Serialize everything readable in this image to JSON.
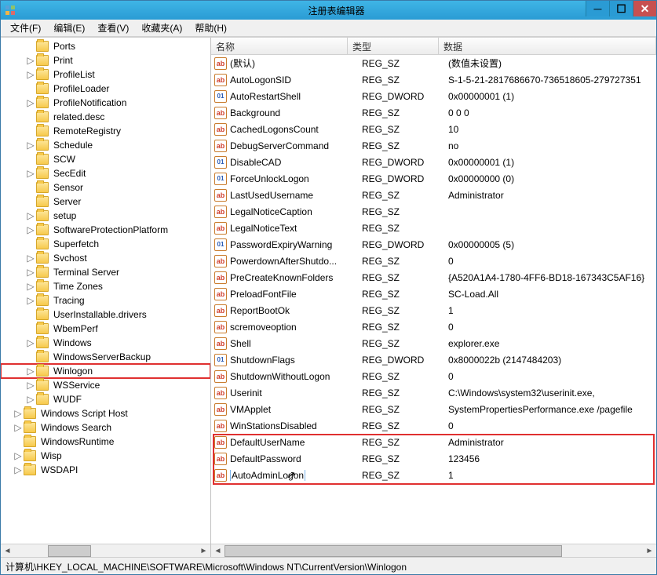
{
  "window": {
    "title": "注册表编辑器"
  },
  "menus": [
    {
      "label": "文件(F)"
    },
    {
      "label": "编辑(E)"
    },
    {
      "label": "查看(V)"
    },
    {
      "label": "收藏夹(A)"
    },
    {
      "label": "帮助(H)"
    }
  ],
  "tree": [
    {
      "indent": 7,
      "exp": "",
      "label": "Ports"
    },
    {
      "indent": 7,
      "exp": "▷",
      "label": "Print"
    },
    {
      "indent": 7,
      "exp": "▷",
      "label": "ProfileList"
    },
    {
      "indent": 7,
      "exp": "",
      "label": "ProfileLoader"
    },
    {
      "indent": 7,
      "exp": "▷",
      "label": "ProfileNotification"
    },
    {
      "indent": 7,
      "exp": "",
      "label": "related.desc"
    },
    {
      "indent": 7,
      "exp": "",
      "label": "RemoteRegistry"
    },
    {
      "indent": 7,
      "exp": "▷",
      "label": "Schedule"
    },
    {
      "indent": 7,
      "exp": "",
      "label": "SCW"
    },
    {
      "indent": 7,
      "exp": "▷",
      "label": "SecEdit"
    },
    {
      "indent": 7,
      "exp": "",
      "label": "Sensor"
    },
    {
      "indent": 7,
      "exp": "",
      "label": "Server"
    },
    {
      "indent": 7,
      "exp": "▷",
      "label": "setup"
    },
    {
      "indent": 7,
      "exp": "▷",
      "label": "SoftwareProtectionPlatform"
    },
    {
      "indent": 7,
      "exp": "",
      "label": "Superfetch"
    },
    {
      "indent": 7,
      "exp": "▷",
      "label": "Svchost"
    },
    {
      "indent": 7,
      "exp": "▷",
      "label": "Terminal Server"
    },
    {
      "indent": 7,
      "exp": "▷",
      "label": "Time Zones"
    },
    {
      "indent": 7,
      "exp": "▷",
      "label": "Tracing"
    },
    {
      "indent": 7,
      "exp": "",
      "label": "UserInstallable.drivers"
    },
    {
      "indent": 7,
      "exp": "",
      "label": "WbemPerf"
    },
    {
      "indent": 7,
      "exp": "▷",
      "label": "Windows"
    },
    {
      "indent": 7,
      "exp": "",
      "label": "WindowsServerBackup"
    },
    {
      "indent": 7,
      "exp": "▷",
      "label": "Winlogon",
      "highlight": true
    },
    {
      "indent": 7,
      "exp": "▷",
      "label": "WSService"
    },
    {
      "indent": 7,
      "exp": "▷",
      "label": "WUDF"
    },
    {
      "indent": 6,
      "exp": "▷",
      "label": "Windows Script Host"
    },
    {
      "indent": 6,
      "exp": "▷",
      "label": "Windows Search"
    },
    {
      "indent": 6,
      "exp": "",
      "label": "WindowsRuntime"
    },
    {
      "indent": 6,
      "exp": "▷",
      "label": "Wisp"
    },
    {
      "indent": 6,
      "exp": "▷",
      "label": "WSDAPI"
    }
  ],
  "list": {
    "columns": {
      "name": "名称",
      "type": "类型",
      "data": "数据"
    },
    "rows": [
      {
        "icon": "sz",
        "name": "(默认)",
        "type": "REG_SZ",
        "data": "(数值未设置)"
      },
      {
        "icon": "sz",
        "name": "AutoLogonSID",
        "type": "REG_SZ",
        "data": "S-1-5-21-2817686670-736518605-279727351"
      },
      {
        "icon": "dw",
        "name": "AutoRestartShell",
        "type": "REG_DWORD",
        "data": "0x00000001 (1)"
      },
      {
        "icon": "sz",
        "name": "Background",
        "type": "REG_SZ",
        "data": "0 0 0"
      },
      {
        "icon": "sz",
        "name": "CachedLogonsCount",
        "type": "REG_SZ",
        "data": "10"
      },
      {
        "icon": "sz",
        "name": "DebugServerCommand",
        "type": "REG_SZ",
        "data": "no"
      },
      {
        "icon": "dw",
        "name": "DisableCAD",
        "type": "REG_DWORD",
        "data": "0x00000001 (1)"
      },
      {
        "icon": "dw",
        "name": "ForceUnlockLogon",
        "type": "REG_DWORD",
        "data": "0x00000000 (0)"
      },
      {
        "icon": "sz",
        "name": "LastUsedUsername",
        "type": "REG_SZ",
        "data": "Administrator"
      },
      {
        "icon": "sz",
        "name": "LegalNoticeCaption",
        "type": "REG_SZ",
        "data": ""
      },
      {
        "icon": "sz",
        "name": "LegalNoticeText",
        "type": "REG_SZ",
        "data": ""
      },
      {
        "icon": "dw",
        "name": "PasswordExpiryWarning",
        "type": "REG_DWORD",
        "data": "0x00000005 (5)"
      },
      {
        "icon": "sz",
        "name": "PowerdownAfterShutdo...",
        "type": "REG_SZ",
        "data": "0"
      },
      {
        "icon": "sz",
        "name": "PreCreateKnownFolders",
        "type": "REG_SZ",
        "data": "{A520A1A4-1780-4FF6-BD18-167343C5AF16}"
      },
      {
        "icon": "sz",
        "name": "PreloadFontFile",
        "type": "REG_SZ",
        "data": "SC-Load.All"
      },
      {
        "icon": "sz",
        "name": "ReportBootOk",
        "type": "REG_SZ",
        "data": "1"
      },
      {
        "icon": "sz",
        "name": "scremoveoption",
        "type": "REG_SZ",
        "data": "0"
      },
      {
        "icon": "sz",
        "name": "Shell",
        "type": "REG_SZ",
        "data": "explorer.exe"
      },
      {
        "icon": "dw",
        "name": "ShutdownFlags",
        "type": "REG_DWORD",
        "data": "0x8000022b (2147484203)"
      },
      {
        "icon": "sz",
        "name": "ShutdownWithoutLogon",
        "type": "REG_SZ",
        "data": "0"
      },
      {
        "icon": "sz",
        "name": "Userinit",
        "type": "REG_SZ",
        "data": "C:\\Windows\\system32\\userinit.exe,"
      },
      {
        "icon": "sz",
        "name": "VMApplet",
        "type": "REG_SZ",
        "data": "SystemPropertiesPerformance.exe /pagefile"
      },
      {
        "icon": "sz",
        "name": "WinStationsDisabled",
        "type": "REG_SZ",
        "data": "0"
      },
      {
        "icon": "sz",
        "name": "DefaultUserName",
        "type": "REG_SZ",
        "data": "Administrator"
      },
      {
        "icon": "sz",
        "name": "DefaultPassword",
        "type": "REG_SZ",
        "data": "123456"
      },
      {
        "icon": "sz",
        "name": "AutoAdminLogon",
        "type": "REG_SZ",
        "data": "1",
        "editing": true
      }
    ]
  },
  "statusbar": "计算机\\HKEY_LOCAL_MACHINE\\SOFTWARE\\Microsoft\\Windows NT\\CurrentVersion\\Winlogon"
}
